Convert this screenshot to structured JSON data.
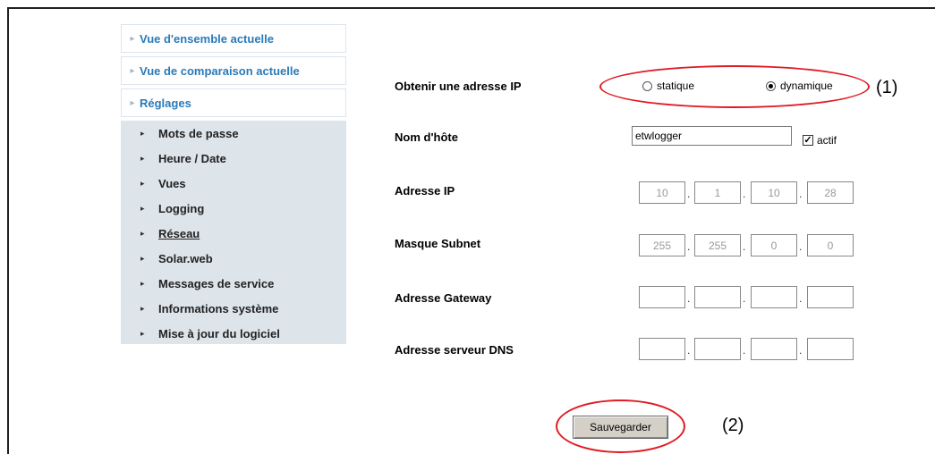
{
  "nav": {
    "main_items": [
      {
        "label": "Vue d'ensemble actuelle"
      },
      {
        "label": "Vue de comparaison actuelle"
      },
      {
        "label": "Réglages"
      }
    ],
    "sub_items": [
      {
        "label": "Mots de passe"
      },
      {
        "label": "Heure / Date"
      },
      {
        "label": "Vues"
      },
      {
        "label": "Logging"
      },
      {
        "label": "Réseau",
        "active": true
      },
      {
        "label": "Solar.web"
      },
      {
        "label": "Messages de service"
      },
      {
        "label": "Informations système"
      },
      {
        "label": "Mise à jour du logiciel"
      }
    ]
  },
  "form": {
    "ip_mode": {
      "label": "Obtenir une adresse IP",
      "options": [
        "statique",
        "dynamique"
      ],
      "selected": "dynamique"
    },
    "hostname": {
      "label": "Nom d'hôte",
      "value": "etwlogger",
      "checkbox_label": "actif",
      "checked": true,
      "check_mark": "✓"
    },
    "ip_address": {
      "label": "Adresse IP",
      "octets": [
        "10",
        "1",
        "10",
        "28"
      ]
    },
    "subnet_mask": {
      "label": "Masque Subnet",
      "octets": [
        "255",
        "255",
        "0",
        "0"
      ]
    },
    "gateway": {
      "label": "Adresse Gateway",
      "octets": [
        "",
        "",
        "",
        ""
      ]
    },
    "dns_server": {
      "label": "Adresse serveur DNS",
      "octets": [
        "",
        "",
        "",
        ""
      ]
    },
    "octet_separator": ".",
    "save_label": "Sauvegarder"
  },
  "annotations": {
    "one": "(1)",
    "two": "(2)"
  },
  "colors": {
    "link": "#2a7ab8",
    "submenu_bg": "#dde4ea",
    "highlight": "#e01b24"
  },
  "icons": {
    "nav_arrow": "triangle-right-icon",
    "submenu_arrow": "chevron-right-icon"
  }
}
